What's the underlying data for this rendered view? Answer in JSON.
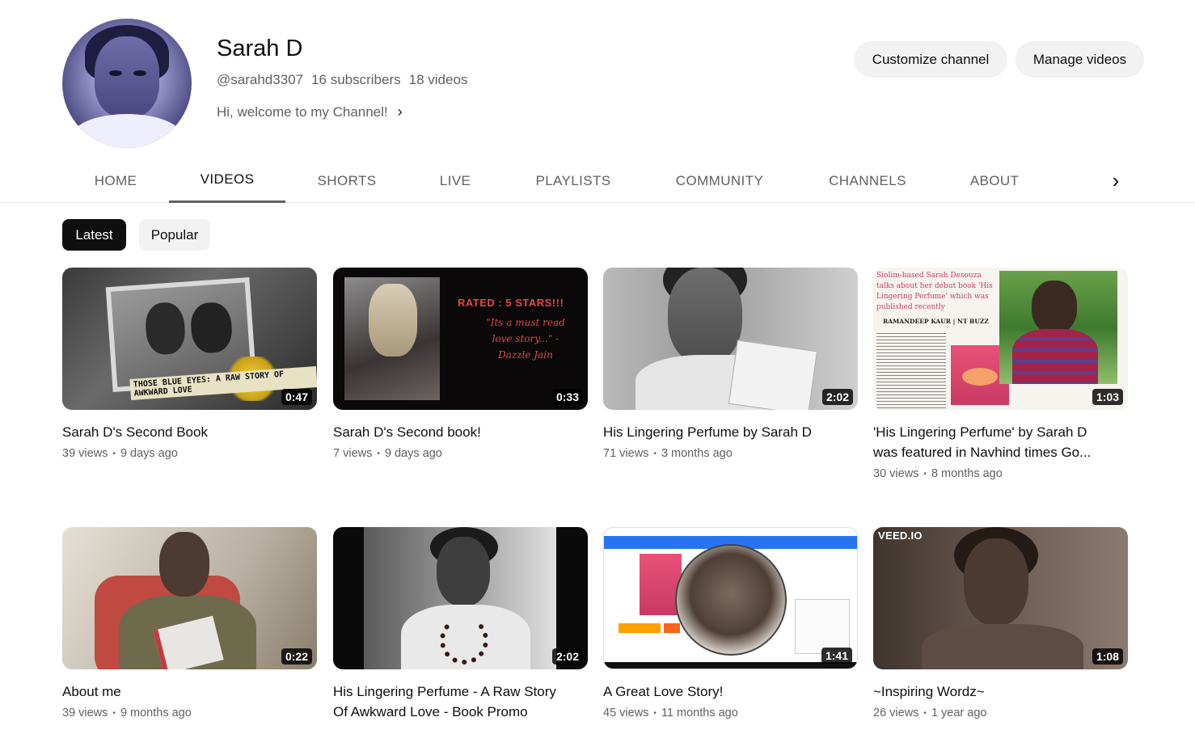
{
  "channel": {
    "name": "Sarah D",
    "handle": "@sarahd3307",
    "subscribers": "16 subscribers",
    "videos_count": "18 videos",
    "description": "Hi, welcome to my Channel!",
    "description_chevron": "›"
  },
  "actions": {
    "customize": "Customize channel",
    "manage": "Manage videos"
  },
  "tabs": [
    {
      "label": "HOME"
    },
    {
      "label": "VIDEOS"
    },
    {
      "label": "SHORTS"
    },
    {
      "label": "LIVE"
    },
    {
      "label": "PLAYLISTS"
    },
    {
      "label": "COMMUNITY"
    },
    {
      "label": "CHANNELS"
    },
    {
      "label": "ABOUT"
    }
  ],
  "tabs_next": "›",
  "filters": {
    "latest": "Latest",
    "popular": "Popular"
  },
  "videos": [
    {
      "title": "Sarah D's Second Book",
      "views": "39 views",
      "age": "9 days ago",
      "duration": "0:47",
      "thumb_text": "THOSE BLUE EYES: A RAW STORY OF AWKWARD LOVE"
    },
    {
      "title": "Sarah D's Second book!",
      "views": "7 views",
      "age": "9 days ago",
      "duration": "0:33",
      "thumb_text": "RATED : 5 STARS!!!",
      "thumb_quote": "\"Its a must read love story...\" -Dazzle Jain"
    },
    {
      "title": "His Lingering Perfume by Sarah D",
      "views": "71 views",
      "age": "3 months ago",
      "duration": "2:02"
    },
    {
      "title": "'His Lingering Perfume' by Sarah D was featured in Navhind times Go...",
      "views": "30 views",
      "age": "8 months ago",
      "duration": "1:03",
      "thumb_headline": "Siolim-based Sarah Desouza talks about her debut book 'His Lingering Perfume' which was published recently",
      "thumb_byline": "RAMANDEEP KAUR | NT BUZZ"
    },
    {
      "title": "About me",
      "views": "39 views",
      "age": "9 months ago",
      "duration": "0:22"
    },
    {
      "title": "His Lingering Perfume - A Raw Story Of Awkward Love - Book Promo",
      "views": "",
      "age": "",
      "duration": "2:02"
    },
    {
      "title": "A Great Love Story!",
      "views": "45 views",
      "age": "11 months ago",
      "duration": "1:41"
    },
    {
      "title": "~Inspiring Wordz~",
      "views": "26 views",
      "age": "1 year ago",
      "duration": "1:08",
      "thumb_watermark": "VEED.IO"
    }
  ],
  "stats_separator": "•"
}
